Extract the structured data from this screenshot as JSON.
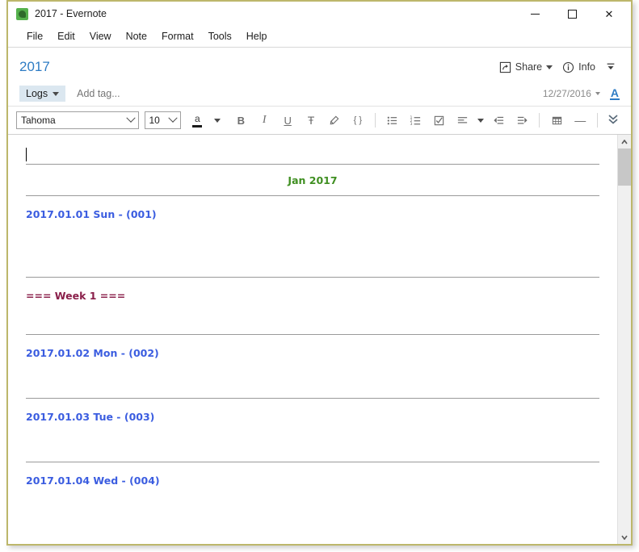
{
  "window": {
    "title": "2017 - Evernote",
    "app_icon": "evernote-elephant-icon",
    "minimize_label": "Minimize",
    "maximize_label": "Maximize",
    "close_label": "✕"
  },
  "menu": {
    "items": [
      {
        "label": "File"
      },
      {
        "label": "Edit"
      },
      {
        "label": "View"
      },
      {
        "label": "Note"
      },
      {
        "label": "Format"
      },
      {
        "label": "Tools"
      },
      {
        "label": "Help"
      }
    ]
  },
  "note_header": {
    "title": "2017",
    "notebook": "Logs",
    "tag_placeholder": "Add tag...",
    "date": "12/27/2016",
    "share_label": "Share",
    "info_label": "Info",
    "text_color_label": "A",
    "collapse_icon": "collapse-chevron-icon"
  },
  "toolbar": {
    "font_family": "Tahoma",
    "font_size": "10",
    "font_color_glyph": "a",
    "bold": "B",
    "italic": "I",
    "underline": "U",
    "strikethrough": "Ŧ",
    "highlight": "✐",
    "code": "{ }",
    "bulleted_list": "☰",
    "numbered_list": "≡",
    "checkbox": "☑",
    "align": "≡",
    "outdent": "⇤",
    "indent": "⇥",
    "table": "▦",
    "horizontal_rule": "—",
    "overflow": "»"
  },
  "note_content": {
    "blocks": [
      {
        "type": "caret"
      },
      {
        "type": "hr"
      },
      {
        "type": "month",
        "text": "Jan 2017"
      },
      {
        "type": "hr"
      },
      {
        "type": "day",
        "text": "2017.01.01 Sun - (001)"
      },
      {
        "type": "spacer-tall"
      },
      {
        "type": "hr"
      },
      {
        "type": "week",
        "text": "=== Week 1 ==="
      },
      {
        "type": "spacer-short"
      },
      {
        "type": "hr"
      },
      {
        "type": "day",
        "text": "2017.01.02 Mon - (002)"
      },
      {
        "type": "spacer-mid"
      },
      {
        "type": "hr"
      },
      {
        "type": "day",
        "text": "2017.01.03 Tue - (003)"
      },
      {
        "type": "spacer-mid"
      },
      {
        "type": "hr"
      },
      {
        "type": "day",
        "text": "2017.01.04 Wed - (004)"
      },
      {
        "type": "spacer-mid"
      }
    ]
  },
  "scrollbar": {
    "up_arrow": "▲",
    "down_arrow": "▼"
  },
  "colors": {
    "note_title": "#2e7cc4",
    "month": "#3f8f21",
    "day": "#3b5de0",
    "week": "#8a1f4a",
    "window_border": "#bdb76b",
    "notebook_chip": "#dbe7f0"
  }
}
